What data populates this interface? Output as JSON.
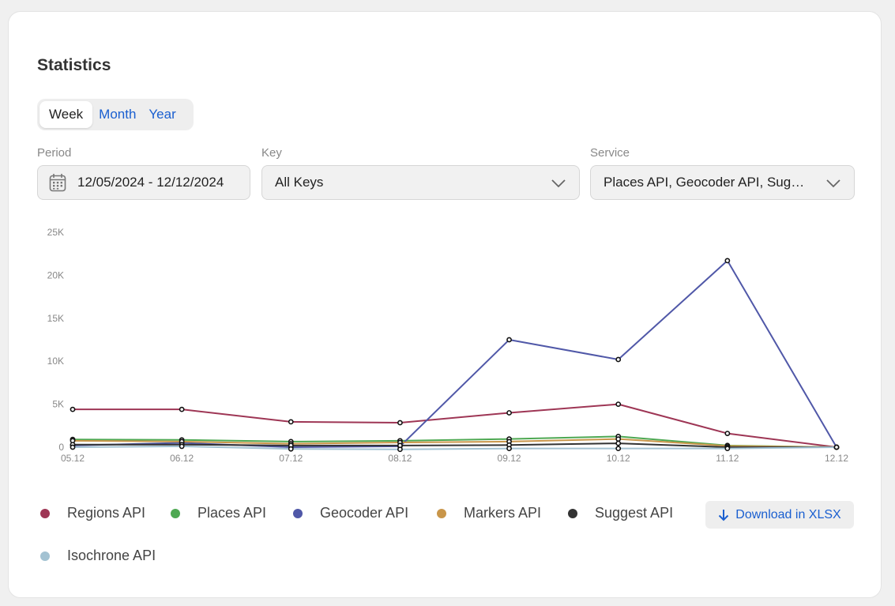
{
  "page": {
    "title": "Statistics"
  },
  "tabs": [
    {
      "label": "Week",
      "active": true
    },
    {
      "label": "Month",
      "active": false
    },
    {
      "label": "Year",
      "active": false
    }
  ],
  "filters": {
    "period": {
      "label": "Period",
      "value": "12/05/2024 - 12/12/2024",
      "icon": "calendar-icon"
    },
    "key": {
      "label": "Key",
      "value": "All Keys",
      "icon": "chevron-down-icon"
    },
    "service": {
      "label": "Service",
      "value": "Places API, Geocoder API, Suggest API, Markers API, Regions API, Isochrone API",
      "icon": "chevron-down-icon"
    }
  },
  "download": {
    "label": "Download in XLSX",
    "icon": "arrow-down-icon"
  },
  "colors": {
    "accent": "#1a5fd0"
  },
  "chart_data": {
    "type": "line",
    "categories": [
      "05.12",
      "06.12",
      "07.12",
      "08.12",
      "09.12",
      "10.12",
      "11.12",
      "12.12"
    ],
    "ylim": [
      0,
      25000
    ],
    "yticks": [
      {
        "value": 0,
        "label": "0"
      },
      {
        "value": 5000,
        "label": "5K"
      },
      {
        "value": 10000,
        "label": "10K"
      },
      {
        "value": 15000,
        "label": "15K"
      },
      {
        "value": 20000,
        "label": "20K"
      },
      {
        "value": 25000,
        "label": "25K"
      }
    ],
    "grid": false,
    "legend": "bottom",
    "series": [
      {
        "name": "Regions API",
        "color": "#9e3655",
        "values": [
          4400,
          4400,
          2950,
          2850,
          4000,
          5000,
          1600,
          0
        ]
      },
      {
        "name": "Places API",
        "color": "#4ea852",
        "values": [
          900,
          850,
          650,
          750,
          950,
          1250,
          200,
          0
        ]
      },
      {
        "name": "Geocoder API",
        "color": "#5058a8",
        "values": [
          200,
          500,
          0,
          100,
          12500,
          10200,
          21700,
          0
        ]
      },
      {
        "name": "Markers API",
        "color": "#c9964a",
        "values": [
          750,
          650,
          400,
          550,
          650,
          950,
          150,
          0
        ]
      },
      {
        "name": "Suggest API",
        "color": "#333333",
        "values": [
          300,
          300,
          200,
          200,
          250,
          450,
          0,
          0
        ]
      },
      {
        "name": "Isochrone API",
        "color": "#a3c2d2",
        "values": [
          0,
          100,
          -200,
          -250,
          -150,
          -150,
          -150,
          0
        ]
      }
    ]
  }
}
